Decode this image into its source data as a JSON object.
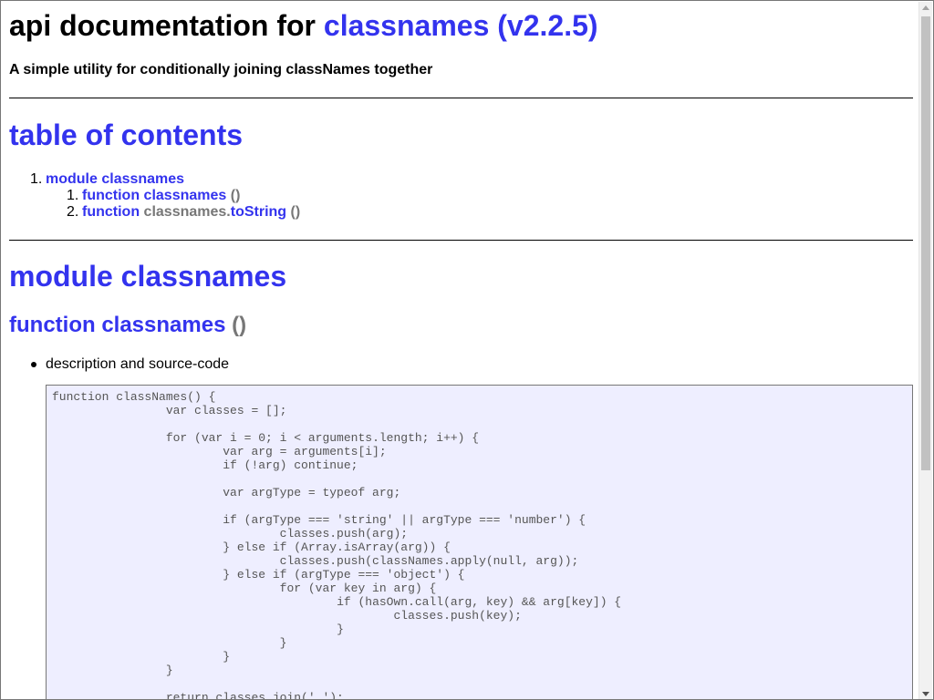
{
  "header": {
    "title_prefix": "api documentation for",
    "title_name": "classnames (v2.2.5)",
    "subtitle": "A simple utility for conditionally joining classNames together"
  },
  "toc": {
    "heading": "table of contents",
    "items": [
      {
        "number": "1.",
        "keyword": "module",
        "name": "classnames",
        "children": [
          {
            "number": "1.",
            "keyword": "function",
            "name": "classnames",
            "parens": "()"
          },
          {
            "number": "2.",
            "keyword": "function",
            "owner": "classnames.",
            "name": "toString",
            "parens": "()"
          }
        ]
      }
    ]
  },
  "module": {
    "heading": "module classnames",
    "function_keyword": "function",
    "function_name": "classnames",
    "function_parens": "()",
    "bullet": "description and source-code"
  },
  "code_lines": [
    "function classNames() {",
    "\t\tvar classes = [];",
    "",
    "\t\tfor (var i = 0; i < arguments.length; i++) {",
    "\t\t\tvar arg = arguments[i];",
    "\t\t\tif (!arg) continue;",
    "",
    "\t\t\tvar argType = typeof arg;",
    "",
    "\t\t\tif (argType === 'string' || argType === 'number') {",
    "\t\t\t\tclasses.push(arg);",
    "\t\t\t} else if (Array.isArray(arg)) {",
    "\t\t\t\tclasses.push(classNames.apply(null, arg));",
    "\t\t\t} else if (argType === 'object') {",
    "\t\t\t\tfor (var key in arg) {",
    "\t\t\t\t\tif (hasOwn.call(arg, key) && arg[key]) {",
    "\t\t\t\t\t\tclasses.push(key);",
    "\t\t\t\t\t}",
    "\t\t\t\t}",
    "\t\t\t}",
    "\t\t}",
    "",
    "\t\treturn classes.join(' ');"
  ],
  "colors": {
    "link": "#3333ee",
    "muted": "#777777",
    "code_background": "#eeeeff"
  }
}
